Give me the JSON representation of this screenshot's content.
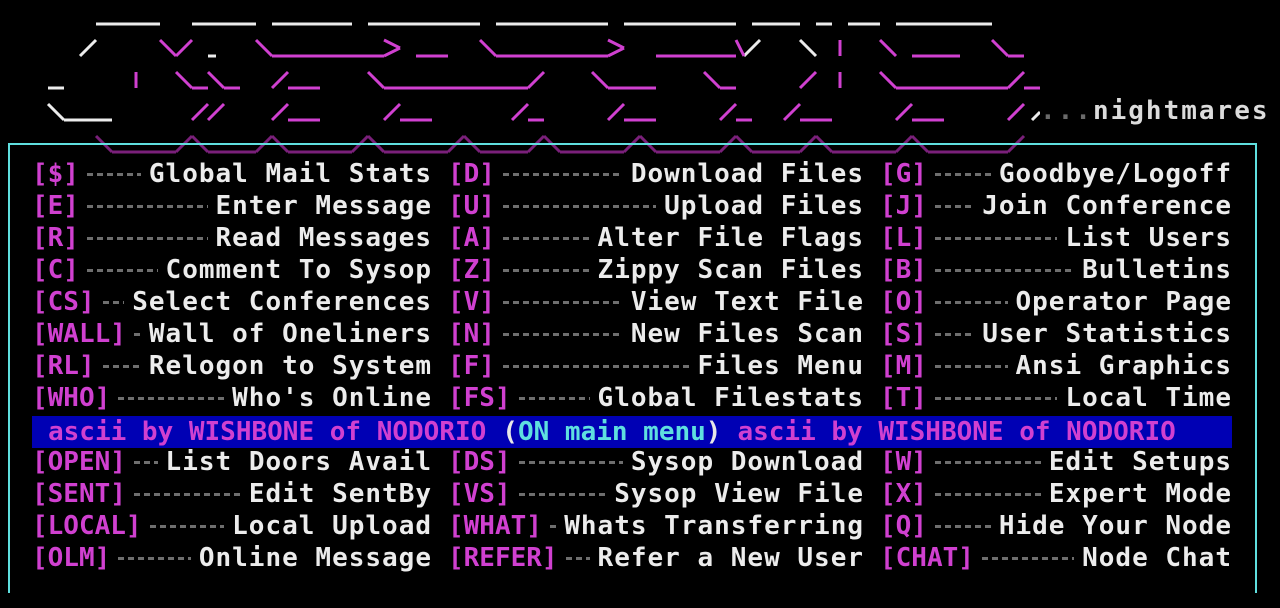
{
  "tagline": {
    "dots": "...",
    "word": "nightmares"
  },
  "band": {
    "credit_left": "ascii by WISHBONE of NODORIO",
    "menu_open": "(",
    "menu_text": "ON main menu",
    "menu_close": ")",
    "credit_right": "ascii by WISHBONE of NODORIO"
  },
  "rows_top": [
    [
      {
        "key": "[$]",
        "label": "Global Mail Stats"
      },
      {
        "key": "[D]",
        "label": "Download Files"
      },
      {
        "key": "[G]",
        "label": "Goodbye/Logoff"
      }
    ],
    [
      {
        "key": "[E]",
        "label": "Enter Message"
      },
      {
        "key": "[U]",
        "label": "Upload Files"
      },
      {
        "key": "[J]",
        "label": "Join Conference"
      }
    ],
    [
      {
        "key": "[R]",
        "label": "Read Messages"
      },
      {
        "key": "[A]",
        "label": "Alter File Flags"
      },
      {
        "key": "[L]",
        "label": "List Users"
      }
    ],
    [
      {
        "key": "[C]",
        "label": "Comment To Sysop"
      },
      {
        "key": "[Z]",
        "label": "Zippy Scan Files"
      },
      {
        "key": "[B]",
        "label": "Bulletins"
      }
    ],
    [
      {
        "key": "[CS]",
        "label": "Select Conferences"
      },
      {
        "key": "[V]",
        "label": "View Text File"
      },
      {
        "key": "[O]",
        "label": "Operator Page"
      }
    ],
    [
      {
        "key": "[WALL]",
        "label": "Wall of Oneliners"
      },
      {
        "key": "[N]",
        "label": "New Files Scan"
      },
      {
        "key": "[S]",
        "label": "User Statistics"
      }
    ],
    [
      {
        "key": "[RL]",
        "label": "Relogon to System"
      },
      {
        "key": "[F]",
        "label": "Files Menu"
      },
      {
        "key": "[M]",
        "label": "Ansi Graphics"
      }
    ],
    [
      {
        "key": "[WHO]",
        "label": "Who's Online"
      },
      {
        "key": "[FS]",
        "label": "Global Filestats"
      },
      {
        "key": "[T]",
        "label": "Local Time"
      }
    ]
  ],
  "rows_bottom": [
    [
      {
        "key": "[OPEN]",
        "label": "List Doors Avail"
      },
      {
        "key": "[DS]",
        "label": "Sysop Download"
      },
      {
        "key": "[W]",
        "label": "Edit Setups"
      }
    ],
    [
      {
        "key": "[SENT]",
        "label": "Edit SentBy"
      },
      {
        "key": "[VS]",
        "label": "Sysop View File"
      },
      {
        "key": "[X]",
        "label": "Expert Mode"
      }
    ],
    [
      {
        "key": "[LOCAL]",
        "label": "Local Upload"
      },
      {
        "key": "[WHAT]",
        "label": "Whats Transferring"
      },
      {
        "key": "[Q]",
        "label": "Hide Your Node"
      }
    ],
    [
      {
        "key": "[OLM]",
        "label": "Online Message"
      },
      {
        "key": "[REFER]",
        "label": "Refer a New User"
      },
      {
        "key": "[CHAT]",
        "label": "Node Chat"
      }
    ]
  ]
}
